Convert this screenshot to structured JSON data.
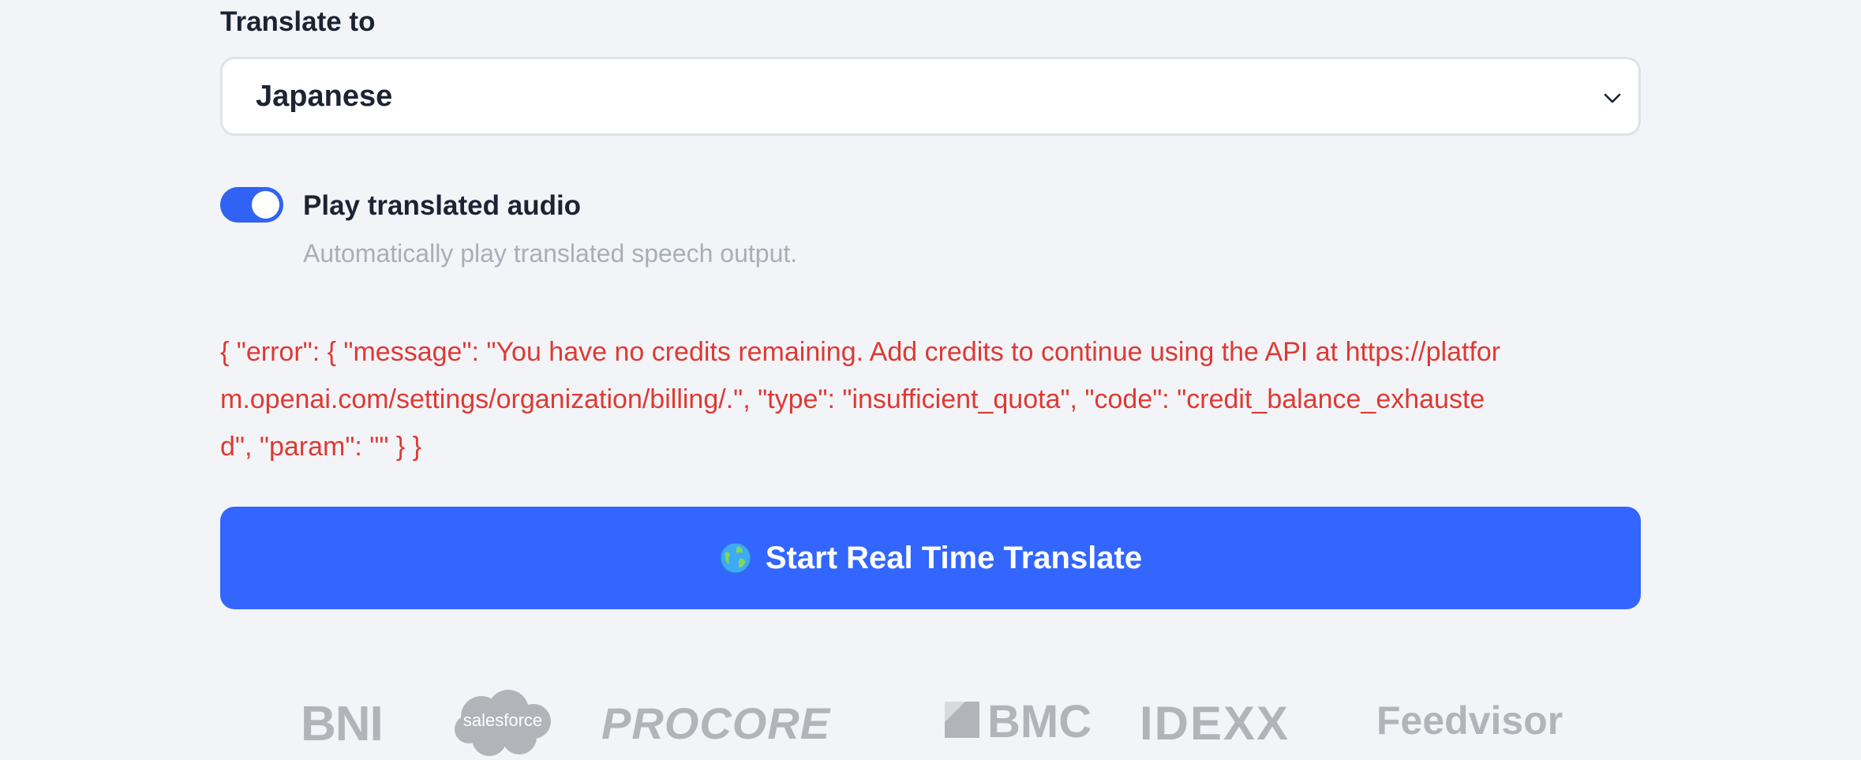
{
  "translate": {
    "label": "Translate to",
    "selected_language": "Japanese"
  },
  "audio_toggle": {
    "label": "Play translated audio",
    "description": "Automatically play translated speech output.",
    "enabled": true
  },
  "error": {
    "message": "{ \"error\": { \"message\": \"You have no credits remaining. Add credits to continue using the API at https://platform.openai.com/settings/organization/billing/.\", \"type\": \"insufficient_quota\", \"code\": \"credit_balance_exhausted\", \"param\": \"\" } }"
  },
  "start_button": {
    "label": "Start Real Time Translate",
    "icon": "globe-icon"
  },
  "logos": {
    "bni": "BNI",
    "salesforce": "salesforce",
    "procore": "PROCORE",
    "bmc": "BMC",
    "idexx": "IDEXX",
    "feedvisor": "Feedvisor"
  },
  "colors": {
    "accent": "#3366ff",
    "error": "#dd3a33",
    "muted_text": "#a9aeb9",
    "logo_gray": "#b2b4b9",
    "background": "#f3f4f8"
  }
}
